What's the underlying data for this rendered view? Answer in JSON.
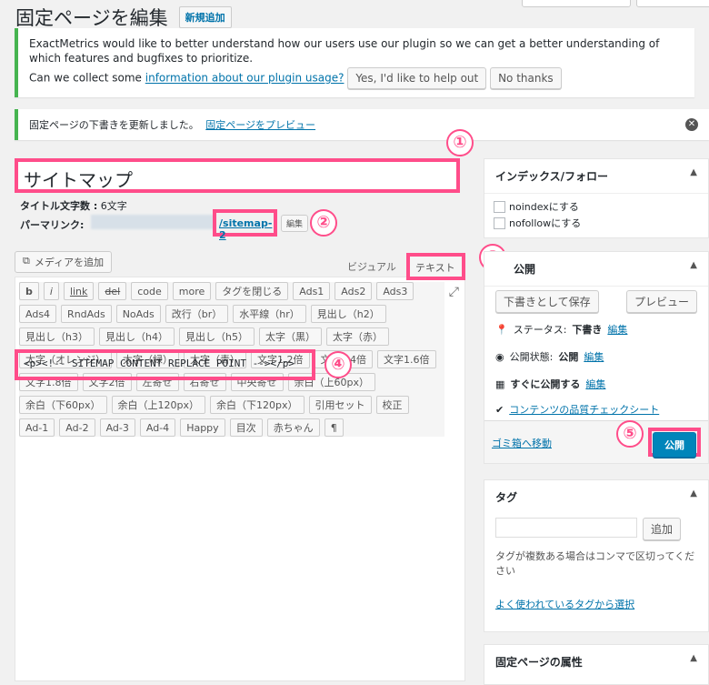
{
  "header": {
    "title": "固定ページを編集",
    "add_new": "新規追加"
  },
  "em_notice": {
    "text1": "ExactMetrics would like to better understand how our users use our plugin so we can get a better understanding of which features and bugfixes to prioritize.",
    "text2": "Can we collect some",
    "link": "information about our plugin usage?",
    "yes_label": "Yes, I'd like to help out",
    "no_label": "No thanks"
  },
  "update_notice": {
    "text": "固定ページの下書きを更新しました。",
    "preview_link": "固定ページをプレビュー"
  },
  "post": {
    "title": "サイトマップ",
    "title_count_label": "タイトル文字数 :",
    "title_count_value": "6文字",
    "permalink_label": "パーマリンク:",
    "slug": "/sitemap-2",
    "edit_label": "編集"
  },
  "editor": {
    "media_label": "メディアを追加",
    "tab_visual": "ビジュアル",
    "tab_text": "テキスト",
    "buttons": [
      "b",
      "i",
      "link",
      "del",
      "code",
      "more",
      "タグを閉じる",
      "Ads1",
      "Ads2",
      "Ads3",
      "Ads4",
      "RndAds",
      "NoAds",
      "改行（br）",
      "水平線（hr）",
      "見出し（h2）",
      "見出し（h3）",
      "見出し（h4）",
      "見出し（h5）",
      "太字（黒）",
      "太字（赤）",
      "太字（オレンジ）",
      "太字（緑）",
      "太字（青）",
      "文字1.2倍",
      "文字1.4倍",
      "文字1.6倍",
      "文字1.8倍",
      "文字2倍",
      "左寄せ",
      "右寄せ",
      "中央寄せ",
      "余白（上60px）",
      "余白（下60px）",
      "余白（上120px）",
      "余白（下120px）",
      "引用セット",
      "校正",
      "Ad-1",
      "Ad-2",
      "Ad-3",
      "Ad-4",
      "Happy",
      "目次",
      "赤ちゃん",
      "¶"
    ],
    "content": "<p><!-- SITEMAP CONTENT REPLACE POINT --></p>"
  },
  "markers": [
    "①",
    "②",
    "③",
    "④",
    "⑤"
  ],
  "sidebar": {
    "index_box": {
      "title": "インデックス/フォロー",
      "options": [
        "noindexにする",
        "nofollowにする"
      ]
    },
    "publish_box": {
      "title_suffix": "公開",
      "save_draft": "下書きとして保存",
      "preview": "プレビュー",
      "status_label": "ステータス:",
      "status_value": "下書き",
      "visibility_label": "公開状態:",
      "visibility_value": "公開",
      "schedule_label": "すぐに公開する",
      "edit_link": "編集",
      "checklist_link": "コンテンツの品質チェックシート",
      "trash": "ゴミ箱へ移動",
      "publish": "公開"
    },
    "tag_box": {
      "title": "タグ",
      "add": "追加",
      "help": "タグが複数ある場合はコンマで区切ってください",
      "popular": "よく使われているタグから選択"
    },
    "attrs_box": {
      "title": "固定ページの属性"
    }
  },
  "colors": {
    "highlight": "#ff4d8a",
    "wp_blue": "#0073aa",
    "success": "#46b450"
  }
}
